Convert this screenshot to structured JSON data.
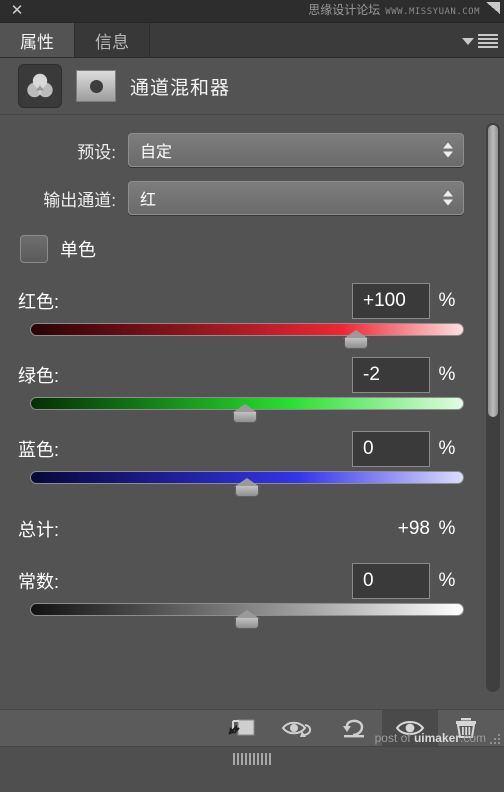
{
  "titlebar": {
    "close_icon": "close-icon",
    "watermark_cn": "思缘设计论坛",
    "watermark_url": "WWW.MISSYUAN.COM"
  },
  "tabs": [
    {
      "label": "属性",
      "active": true
    },
    {
      "label": "信息",
      "active": false
    }
  ],
  "panel_menu": {
    "icon": "panel-menu-icon"
  },
  "header": {
    "adjustment_icon": "channel-mixer-icon",
    "mask_thumbnail": "layer-mask-thumbnail",
    "title": "通道混和器"
  },
  "preset": {
    "label": "预设:",
    "value": "自定"
  },
  "output_channel": {
    "label": "输出通道:",
    "value": "红"
  },
  "monochrome": {
    "label": "单色",
    "checked": false
  },
  "sliders": [
    {
      "name": "红色:",
      "value": "+100",
      "unit": "%",
      "thumb_percent": 75,
      "track": "red"
    },
    {
      "name": "绿色:",
      "value": "-2",
      "unit": "%",
      "thumb_percent": 49.5,
      "track": "green"
    },
    {
      "name": "蓝色:",
      "value": "0",
      "unit": "%",
      "thumb_percent": 50,
      "track": "blue"
    }
  ],
  "total": {
    "label": "总计:",
    "value": "+98",
    "unit": "%"
  },
  "constant": {
    "name": "常数:",
    "value": "0",
    "unit": "%",
    "thumb_percent": 50,
    "track": "gray"
  },
  "footer": {
    "buttons": [
      {
        "name": "clip-to-layer-button",
        "icon": "clip-to-layer-icon",
        "pressed": false
      },
      {
        "name": "preview-previous-button",
        "icon": "eye-arrow-icon",
        "pressed": false
      },
      {
        "name": "reset-button",
        "icon": "reset-arrow-icon",
        "pressed": false
      },
      {
        "name": "toggle-visibility-button",
        "icon": "eye-icon",
        "pressed": true
      },
      {
        "name": "delete-layer-button",
        "icon": "trash-icon",
        "pressed": false
      }
    ],
    "watermark_prefix": "post of ",
    "watermark_brand": "uimaker",
    "watermark_suffix": ".com"
  },
  "colors": {
    "panel_bg": "#535353",
    "titlebar_bg": "#2d2d2d",
    "tab_active_bg": "#535353",
    "tab_inactive_bg": "#383838",
    "input_bg": "#3a3a3a",
    "text": "#ffffff"
  }
}
